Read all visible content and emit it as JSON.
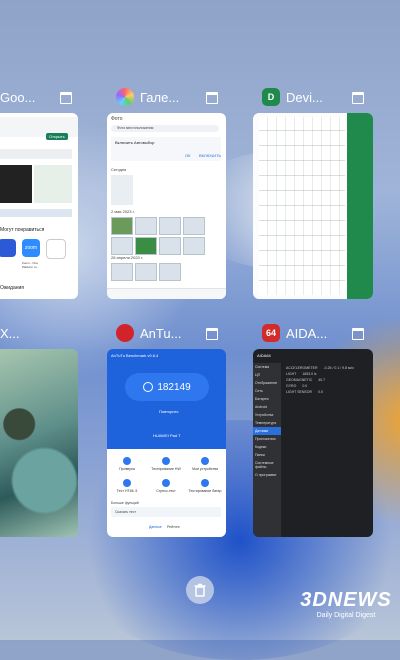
{
  "recents": {
    "cards": [
      {
        "id": "play-store",
        "title": "Goo...",
        "icon": "google-play-icon"
      },
      {
        "id": "gallery",
        "title": "Гале...",
        "icon": "gallery-icon",
        "content": {
          "header": "Фото",
          "search": "Фото местоположения",
          "section": "Сегодня",
          "date1": "2 мая 2023 г.",
          "date2": "28 апреля 2023 г.",
          "banner_title": "Включить Автовыбор",
          "banner_ok": "ОК",
          "banner_enable": "ВКЛЮЧИТЬ"
        }
      },
      {
        "id": "devcheck",
        "title": "Devi...",
        "icon": "devcheck-icon",
        "badge": "D"
      },
      {
        "id": "photo",
        "title": "X..."
      },
      {
        "id": "antutu",
        "title": "AnTu...",
        "icon": "antutu-icon",
        "content": {
          "header": "AnTuTu Benchmark v9.6.4",
          "score": "182149",
          "retest": "Повторить",
          "device": "HUAWEI Pad T",
          "items": [
            "Проверка",
            "Тестирование HW",
            "Мои устройства",
            "Тест HTML 5",
            "Стресс-тест",
            "Тестирование батар"
          ],
          "footer_info": "Больше функций",
          "promo": "Скачать тест",
          "nav_home": "Данные",
          "nav_tests": "Рейтинг"
        }
      },
      {
        "id": "aida64",
        "title": "AIDA...",
        "icon": "aida64-icon",
        "badge": "64",
        "content": {
          "header": "AIDA64",
          "side": [
            "Система",
            "ЦП",
            "Отображение",
            "Сеть",
            "Батарея",
            "Android",
            "Устройства",
            "Температура",
            "Датчики",
            "Приложения",
            "Кодеки",
            "Папки",
            "Системные файлы",
            "О программе"
          ],
          "selected": "Датчики",
          "rows": [
            {
              "k": "ACCELEROMETER",
              "v": "-0.25 / 0.1 / 9.8 м/с²"
            },
            {
              "k": "LIGHT",
              "v": "1653.0 lx"
            },
            {
              "k": "GEOMAGNETIC",
              "v": "40.7"
            },
            {
              "k": "GYRO",
              "v": "0.0"
            },
            {
              "k": "LIGHT SENSOR",
              "v": "0.0"
            }
          ]
        }
      }
    ],
    "play_store": {
      "install": "Открыть",
      "section": "Могут понравиться",
      "section2": "Ожидания",
      "apps": [
        {
          "name": "Zoom - One Platform to...",
          "rating": "4.2"
        },
        {
          "name": "Microsoft Authenticator",
          "rating": "4.6"
        },
        {
          "name": "Microsoft Authenticator",
          "rating": "4.6"
        }
      ]
    },
    "clear_all_icon": "trash-icon"
  },
  "watermark": {
    "brand": "3DNEWS",
    "tagline": "Daily Digital Digest"
  },
  "colors": {
    "antutu": "#1e63db",
    "aida_bg": "#1f2024",
    "aida_badge": "#d12b2b",
    "devcheck": "#1f8a4c"
  }
}
